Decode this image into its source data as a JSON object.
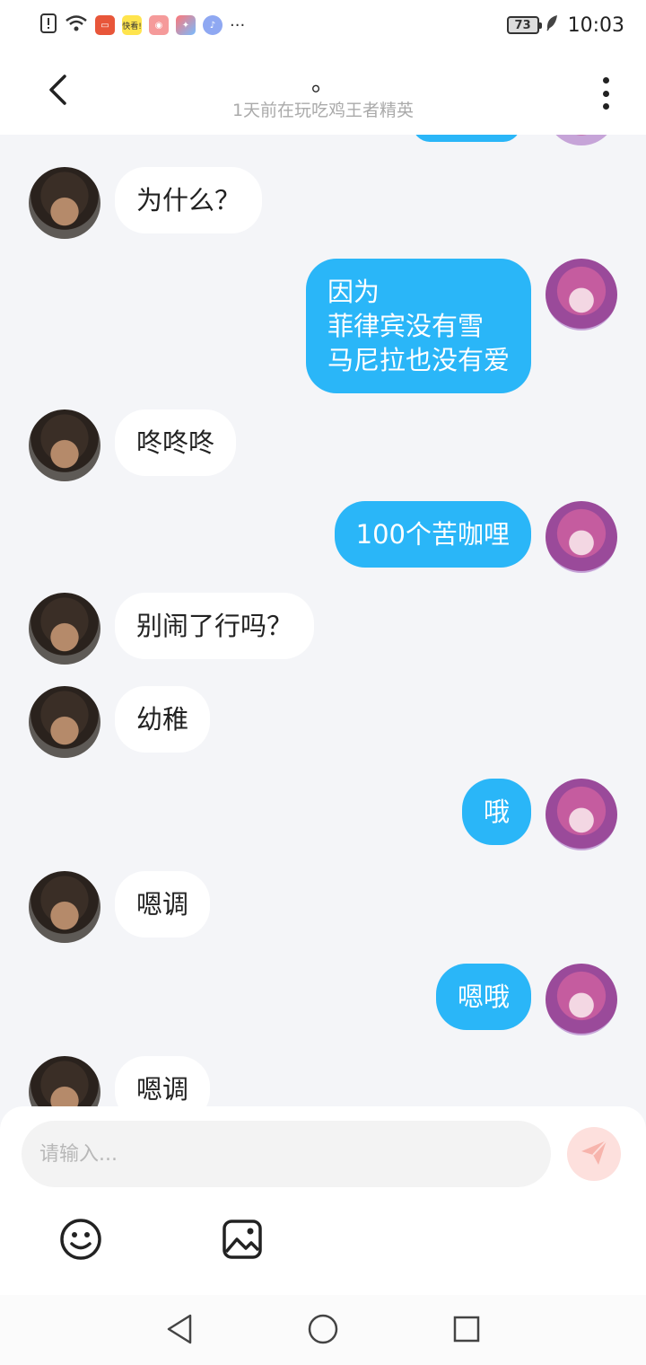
{
  "status_bar": {
    "battery": "73",
    "time": "10:03",
    "app_icon_label": "快看!",
    "more": "···"
  },
  "header": {
    "title": "。",
    "subtitle": "1天前在玩吃鸡王者精英"
  },
  "messages": [
    {
      "side": "left",
      "text": "为什么？"
    },
    {
      "side": "right",
      "text": "因为\n菲律宾没有雪\n马尼拉也没有爱"
    },
    {
      "side": "left",
      "text": "咚咚咚"
    },
    {
      "side": "right",
      "text": "100个苦咖哩"
    },
    {
      "side": "left",
      "text": "别闹了行吗？"
    },
    {
      "side": "left",
      "text": "幼稚"
    },
    {
      "side": "right",
      "text": "哦"
    },
    {
      "side": "left",
      "text": "嗯调"
    },
    {
      "side": "right",
      "text": "嗯哦"
    },
    {
      "side": "left",
      "text": "嗯调"
    }
  ],
  "input": {
    "placeholder": "请输入..."
  },
  "colors": {
    "accent_blue": "#2ab6f8",
    "send_bg": "#fde0dd",
    "send_icon": "#f7b4ac"
  },
  "icons": {
    "back": "chevron-left-icon",
    "more": "more-vertical-icon",
    "send": "paper-plane-icon",
    "emoji": "smiley-icon",
    "image": "image-icon",
    "nav_back": "triangle-back-icon",
    "nav_home": "circle-home-icon",
    "nav_recent": "square-recent-icon"
  }
}
